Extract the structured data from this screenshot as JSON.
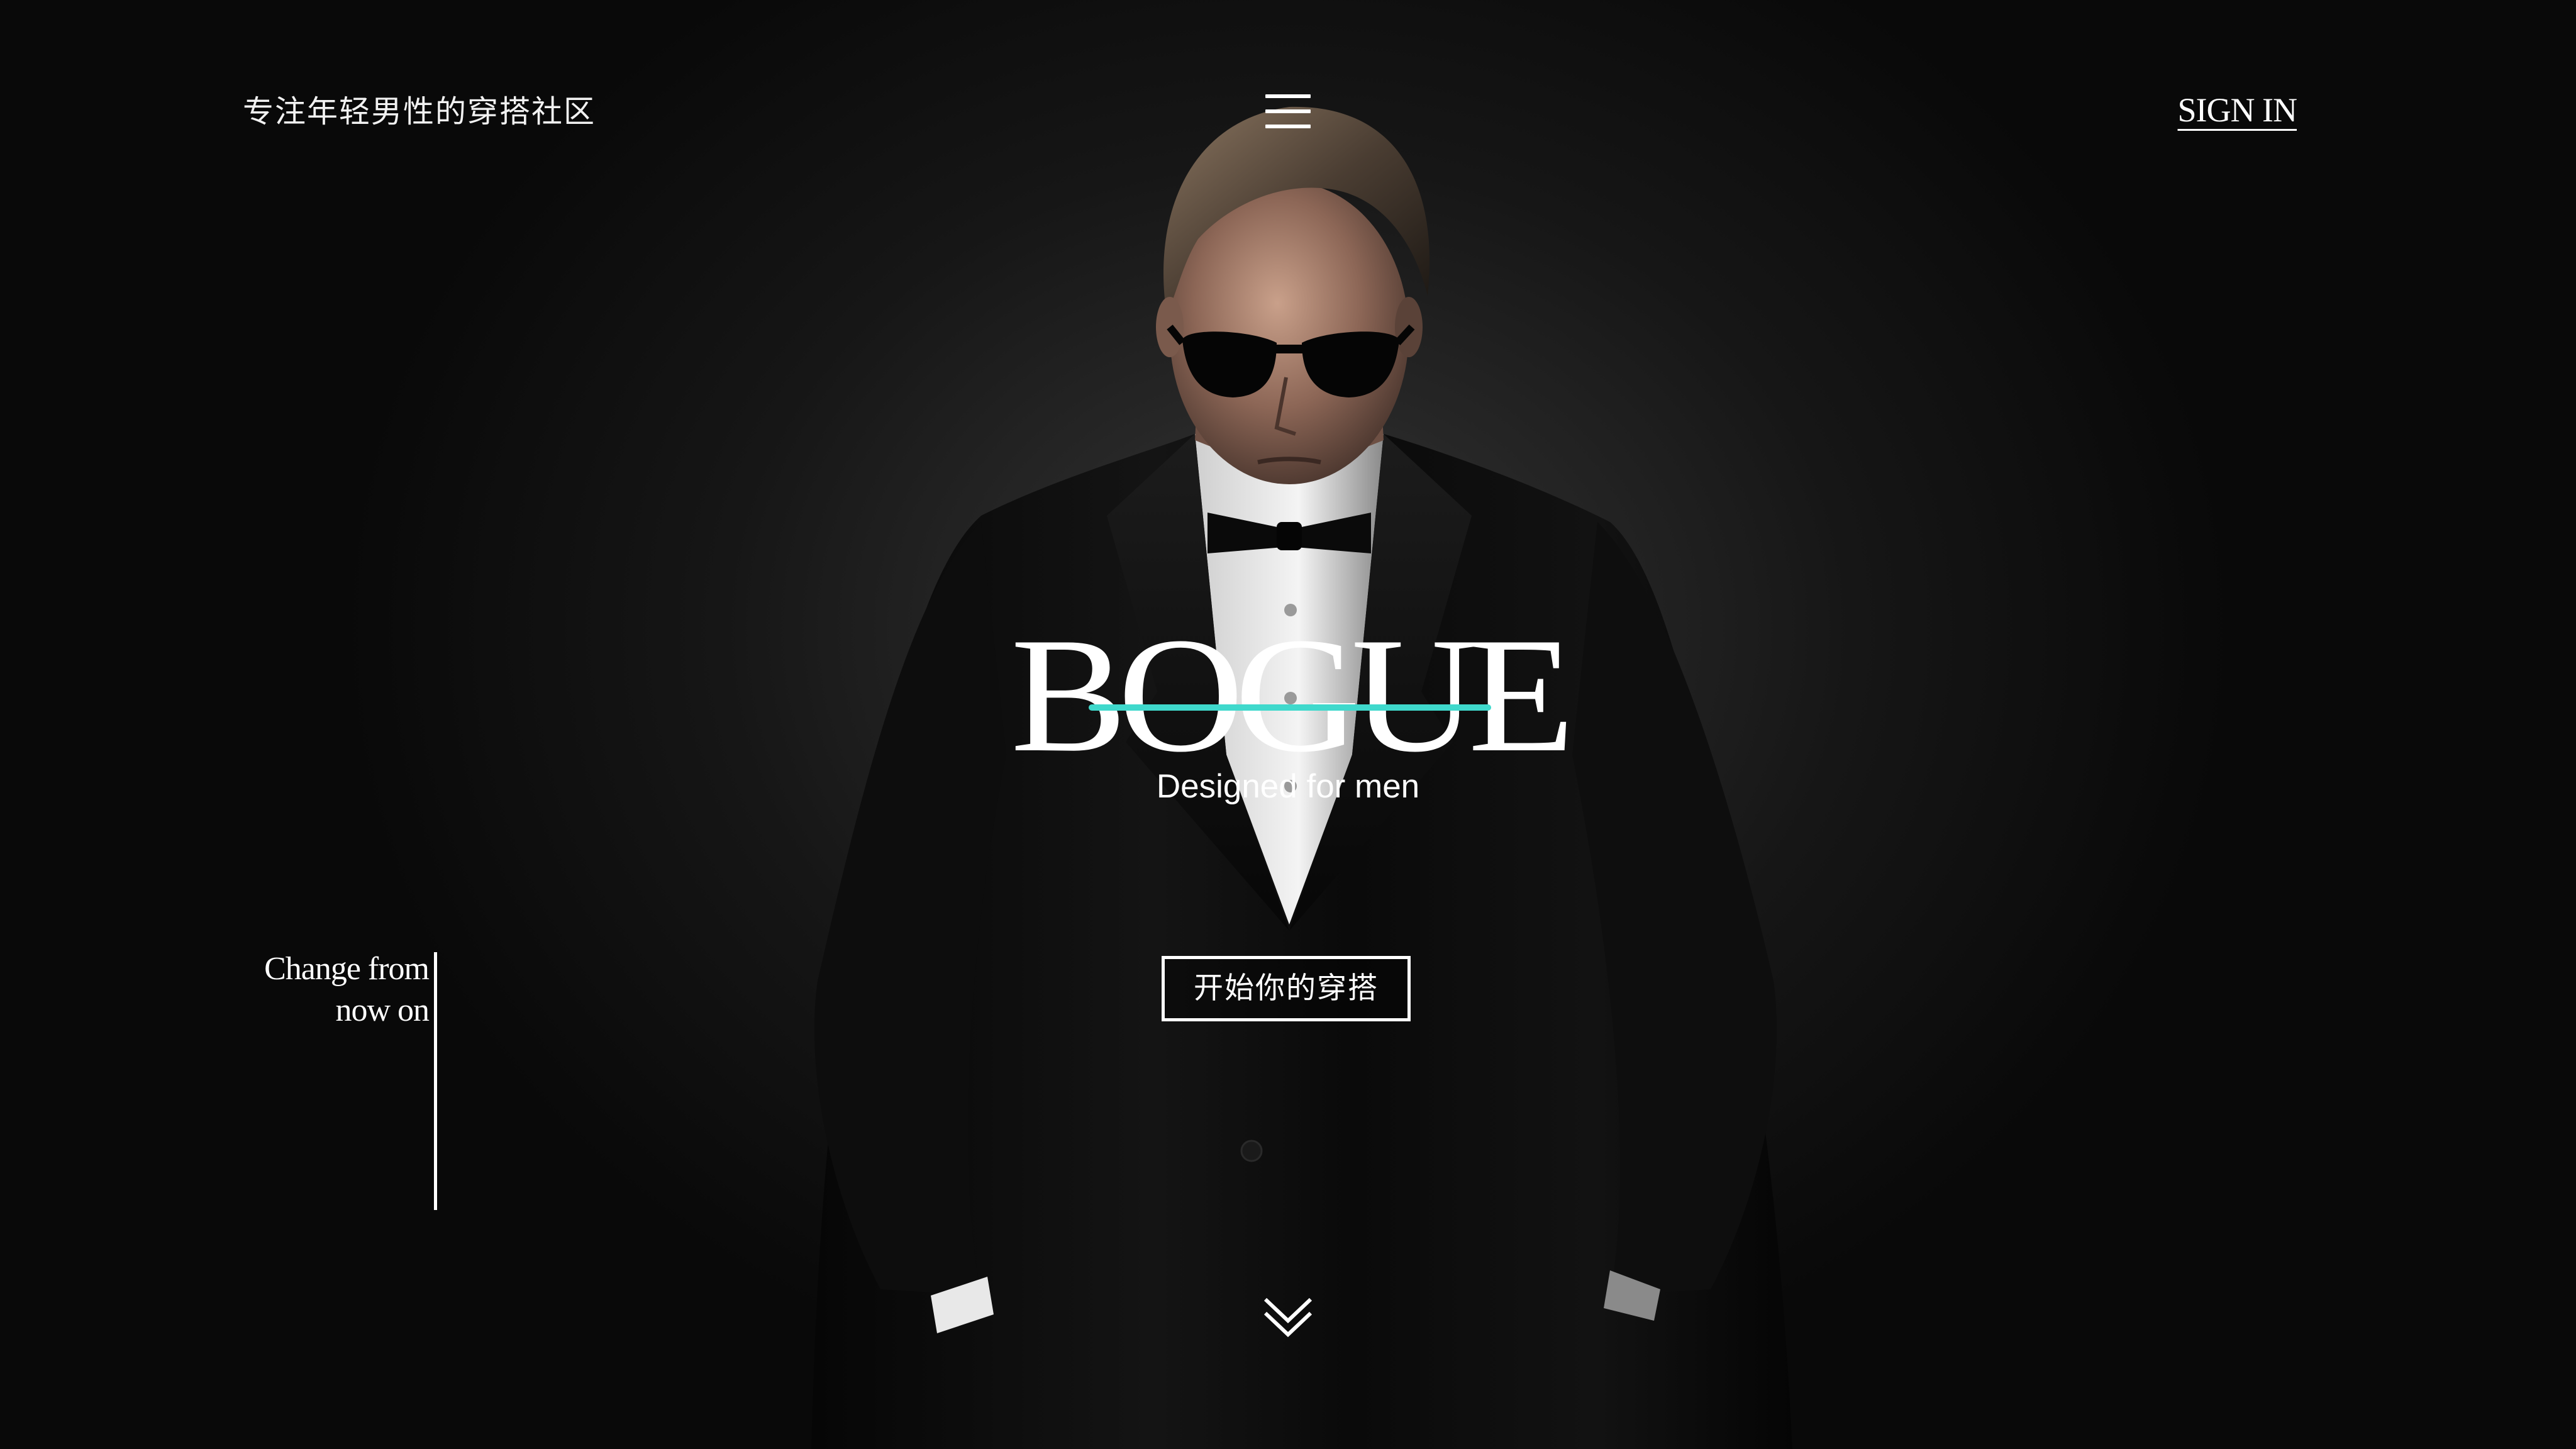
{
  "header": {
    "tagline": "专注年轻男性的穿搭社区",
    "menu_icon": "hamburger-menu-icon",
    "sign_in_label": "SIGN IN"
  },
  "brand": {
    "name": "BOGUE",
    "subtitle": "Designed for men",
    "accent_color": "#3fd9cc"
  },
  "cta": {
    "label": "开始你的穿搭"
  },
  "side_slogan": {
    "line1": "Change from",
    "line2": "now on"
  },
  "scroll": {
    "icon": "double-chevron-down-icon"
  },
  "hero_image": {
    "icon": "man-in-suit-photo"
  }
}
